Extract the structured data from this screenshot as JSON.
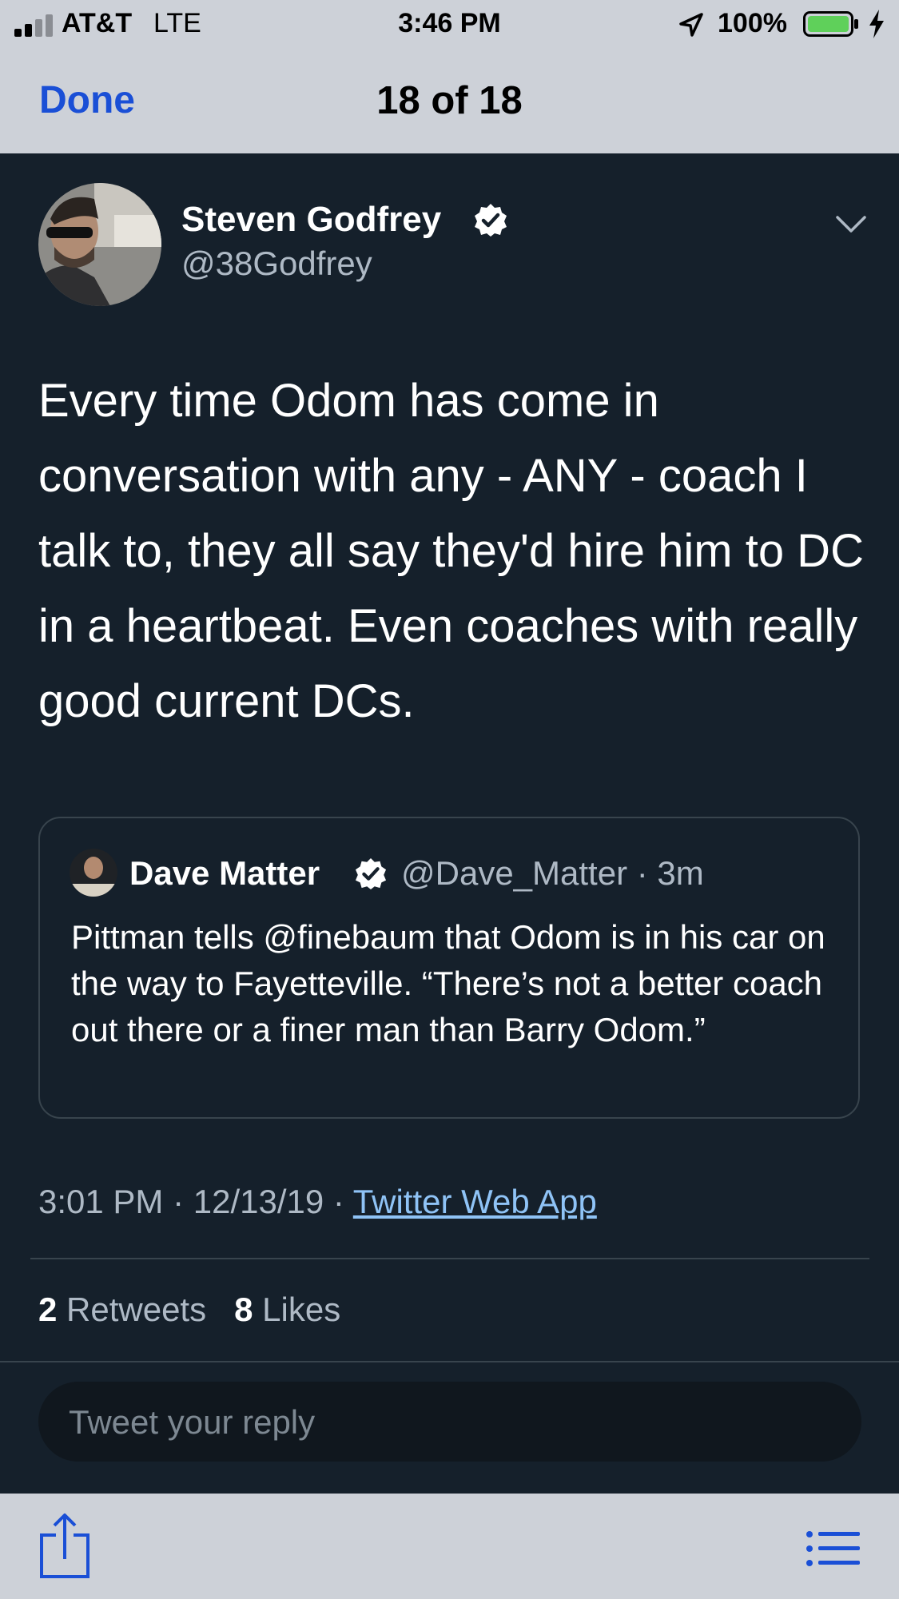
{
  "status_bar": {
    "carrier": "AT&T",
    "network": "LTE",
    "time": "3:46 PM",
    "battery_percent": "100%",
    "battery_color": "#5fd05a"
  },
  "nav": {
    "done_label": "Done",
    "counter": "18 of 18"
  },
  "tweet": {
    "author_name": "Steven Godfrey",
    "handle": "@38Godfrey",
    "text": "Every time Odom has come in conversation with any - ANY - coach I talk to, they all say they'd hire him to DC in a heartbeat. Even coaches with really good current DCs.",
    "timestamp": "3:01 PM · 12/13/19 · ",
    "source": "Twitter Web App",
    "retweets_count": "2",
    "retweets_label": " Retweets",
    "likes_count": "8",
    "likes_label": " Likes"
  },
  "quoted_tweet": {
    "author_name": "Dave Matter",
    "handle_time": "@Dave_Matter · 3m",
    "text": "Pittman tells @finebaum that Odom is in his car on the way to Fayetteville. “There’s not a better coach out there or a finer man than Barry Odom.”"
  },
  "reply": {
    "placeholder": "Tweet your reply"
  },
  "icons": {
    "more": "chevron-down-icon",
    "share": "share-icon",
    "list": "list-icon"
  },
  "colors": {
    "background": "#15202b",
    "accent_blue": "#1a4fd6",
    "link": "#8fc3f6",
    "secondary_text": "#aeb9c5"
  }
}
